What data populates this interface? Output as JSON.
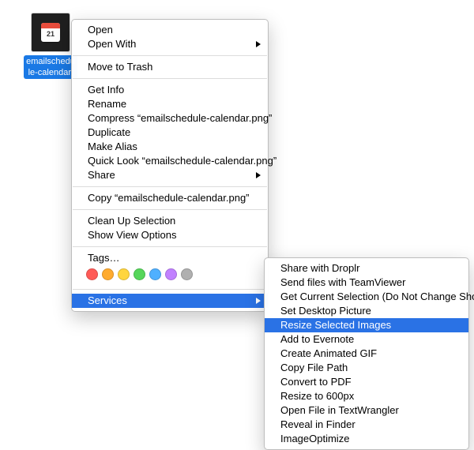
{
  "file": {
    "name": "emailschedule-calendar.png",
    "label_display": "emailschedule-calendar.p",
    "calendar_day": "21"
  },
  "context_menu": {
    "open": "Open",
    "open_with": "Open With",
    "move_to_trash": "Move to Trash",
    "get_info": "Get Info",
    "rename": "Rename",
    "compress": "Compress “emailschedule-calendar.png”",
    "duplicate": "Duplicate",
    "make_alias": "Make Alias",
    "quick_look": "Quick Look “emailschedule-calendar.png”",
    "share": "Share",
    "copy": "Copy “emailschedule-calendar.png”",
    "clean_up": "Clean Up Selection",
    "view_options": "Show View Options",
    "tags": "Tags…",
    "services": "Services"
  },
  "tag_colors": [
    "#ff5b57",
    "#ffab2e",
    "#ffd53e",
    "#56d65b",
    "#4fb0ff",
    "#c181ff",
    "#b0b0b0"
  ],
  "services_menu": {
    "items": [
      "Share with Droplr",
      "Send files with TeamViewer",
      "Get Current Selection (Do Not Change Shortcut)",
      "Set Desktop Picture",
      "Resize Selected Images",
      "Add to Evernote",
      "Create Animated GIF",
      "Copy File Path",
      "Convert to PDF",
      "Resize to 600px",
      "Open File in TextWrangler",
      "Reveal in Finder",
      "ImageOptimize"
    ],
    "highlighted_index": 4
  },
  "colors": {
    "highlight": "#2a72e5"
  }
}
